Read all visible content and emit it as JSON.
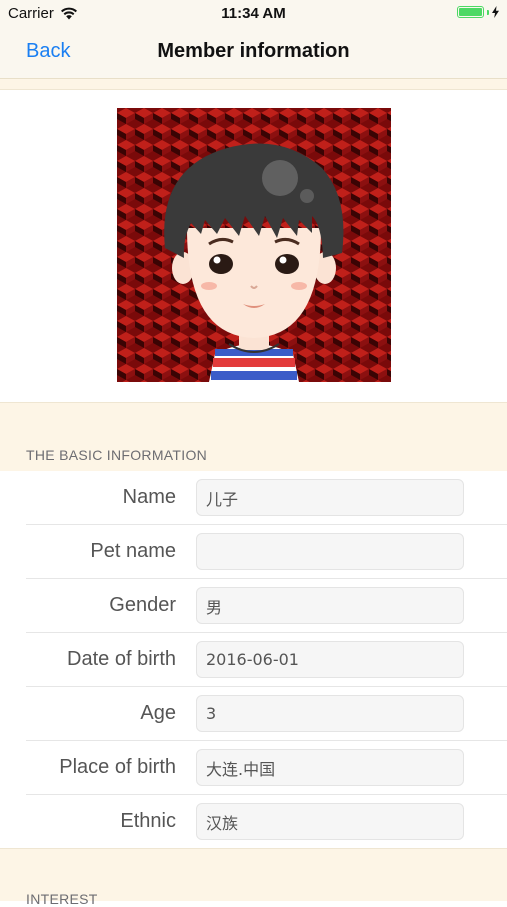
{
  "status_bar": {
    "carrier": "Carrier",
    "time": "11:34 AM",
    "battery_color": "#4cd964"
  },
  "nav": {
    "back_label": "Back",
    "title": "Member information",
    "accent": "#1a7ff2"
  },
  "basic_section": {
    "title": "THE BASIC INFORMATION",
    "fields": [
      {
        "label": "Name",
        "value": "儿子",
        "placeholder": ""
      },
      {
        "label": "Pet name",
        "value": "",
        "placeholder": ""
      },
      {
        "label": "Gender",
        "value": "男",
        "placeholder": ""
      },
      {
        "label": "Date of birth",
        "value": "2016-06-01",
        "placeholder": ""
      },
      {
        "label": "Age",
        "value": "3",
        "placeholder": ""
      },
      {
        "label": "Place of birth",
        "value": "大连.中国",
        "placeholder": ""
      },
      {
        "label": "Ethnic",
        "value": "汉族",
        "placeholder": ""
      }
    ]
  },
  "interest_section": {
    "title": "INTEREST"
  },
  "colors": {
    "section_bg": "#fdf5e6",
    "nav_bg": "#faf7ef",
    "avatar_bg": "#8b0d0d"
  }
}
